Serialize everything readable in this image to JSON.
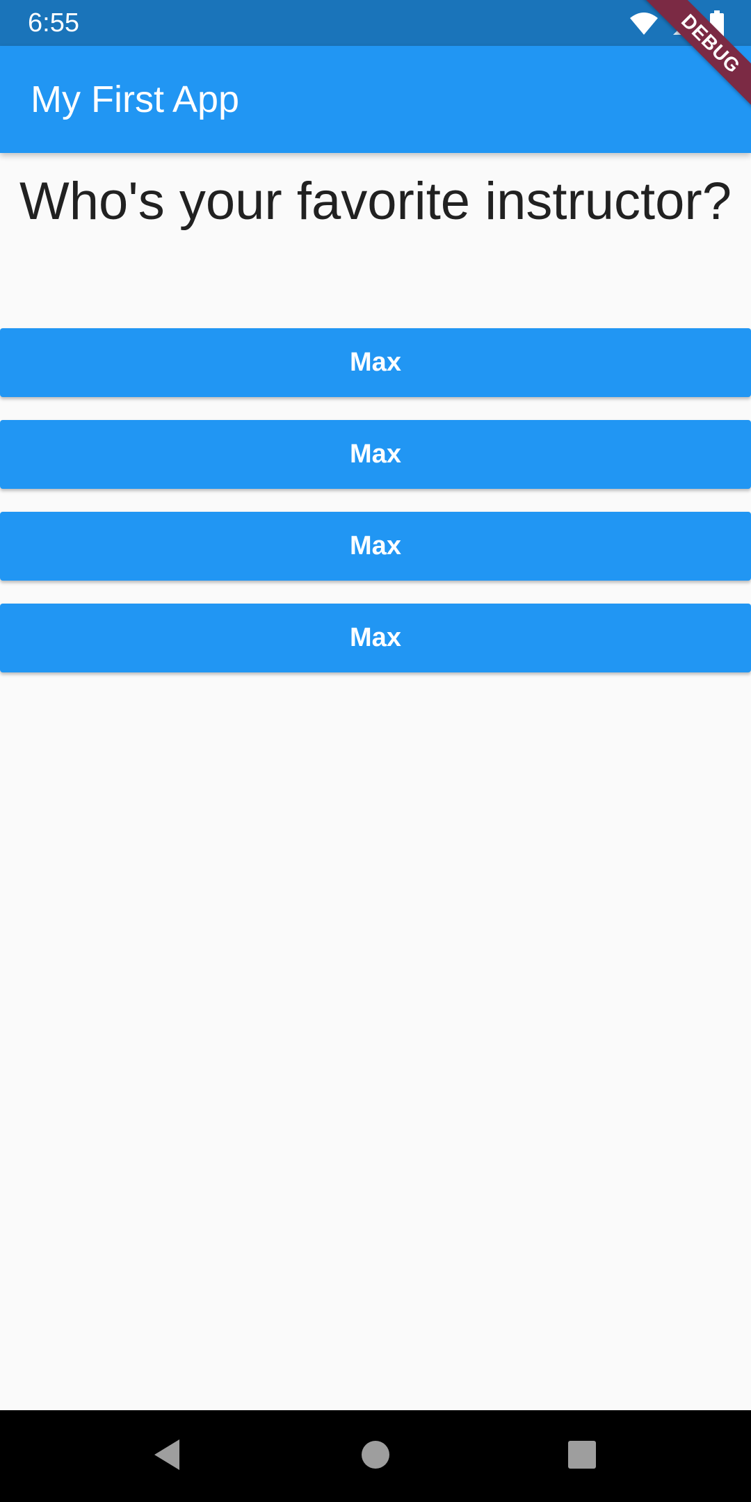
{
  "status_bar": {
    "time": "6:55",
    "icons": [
      "wifi-icon",
      "signal-icon",
      "battery-icon"
    ]
  },
  "debug_banner": {
    "label": "DEBUG",
    "color": "#7b2a44"
  },
  "app_bar": {
    "title": "My First App",
    "color": "#2196f3"
  },
  "question": {
    "text": "Who's your favorite instructor?"
  },
  "answers": [
    {
      "label": "Max"
    },
    {
      "label": "Max"
    },
    {
      "label": "Max"
    },
    {
      "label": "Max"
    }
  ],
  "nav_bar": {
    "icons": [
      "back-icon",
      "home-icon",
      "recents-icon"
    ]
  },
  "colors": {
    "primary": "#2196f3",
    "status_bar": "#1a74ba",
    "background": "#fafafa",
    "text": "#212121"
  }
}
